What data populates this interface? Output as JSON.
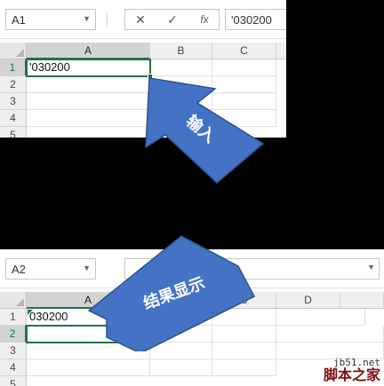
{
  "top": {
    "namebox": "A1",
    "fx_symbol": "fx",
    "formula": "'030200",
    "columns": [
      "A",
      "B",
      "C"
    ],
    "rows": [
      "1",
      "2",
      "3",
      "4",
      "5"
    ],
    "cell_a1": "'030200"
  },
  "bottom": {
    "namebox": "A2",
    "columns": [
      "A",
      "B",
      "C",
      "D"
    ],
    "rows": [
      "1",
      "2",
      "3",
      "4",
      "5"
    ],
    "cell_a1": "030200"
  },
  "callouts": {
    "input": "输入",
    "result": "结果显示"
  },
  "watermark": {
    "url": "jb51.net",
    "name": "脚本之家"
  },
  "colors": {
    "excel_green": "#217346",
    "arrow_blue": "#4472c4"
  }
}
